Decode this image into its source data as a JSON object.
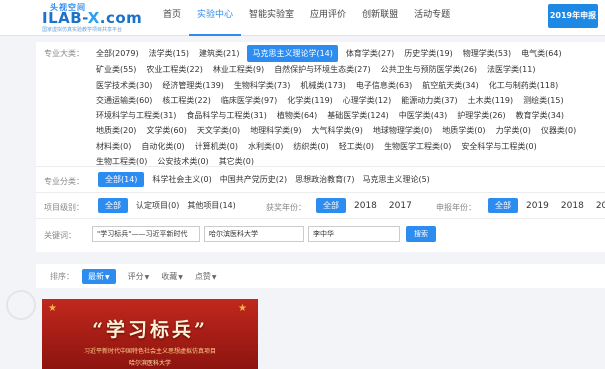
{
  "logo": {
    "top": "头视空间",
    "main": "ILAB-",
    "main_x": "X",
    "main_tail": ".com",
    "sub": "国家虚拟仿真实验教学项目共享平台"
  },
  "nav": [
    "首页",
    "实验中心",
    "智能实验室",
    "应用评价",
    "创新联盟",
    "活动专题"
  ],
  "nav_active": 1,
  "year_badge": "2019年申报",
  "filters": {
    "major_label": "专业大类：",
    "categories": [
      "全部(2079)",
      "法学类(15)",
      "建筑类(21)",
      "马克思主义理论学(14)",
      "体育学类(27)",
      "历史学类(19)",
      "物理学类(53)",
      "电气类(64)",
      "矿业类(55)",
      "农业工程类(22)",
      "林业工程类(9)",
      "自然保护与环境生态类(27)",
      "公共卫生与预防医学类(26)",
      "法医学类(11)",
      "医学技术类(30)",
      "经济管理类(139)",
      "生物科学类(73)",
      "机械类(173)",
      "电子信息类(63)",
      "航空航天类(34)",
      "化工与制药类(118)",
      "交通运输类(60)",
      "核工程类(22)",
      "临床医学类(97)",
      "化学类(119)",
      "心理学类(12)",
      "能源动力类(37)",
      "土木类(119)",
      "测绘类(15)",
      "环境科学与工程类(31)",
      "食品科学与工程类(31)",
      "植物类(64)",
      "基础医学类(124)",
      "中医学类(43)",
      "护理学类(26)",
      "教育学类(34)",
      "地质类(20)",
      "文学类(60)",
      "天文学类(0)",
      "地理科学类(9)",
      "大气科学类(9)",
      "地球物理学类(0)",
      "地质学类(0)",
      "力学类(0)",
      "仪器类(0)",
      "材料类(0)",
      "自动化类(0)",
      "计算机类(0)",
      "水利类(0)",
      "纺织类(0)",
      "轻工类(0)",
      "生物医学工程类(0)",
      "安全科学与工程类(0)",
      "生物工程类(0)",
      "公安技术类(0)",
      "其它类(0)"
    ],
    "selected_category": 3,
    "sub_label": "专业分类：",
    "sub_options": [
      "全部(14)",
      "科学社会主义(0)",
      "中国共产党历史(2)",
      "思想政治教育(7)",
      "马克思主义理论(5)"
    ],
    "level_label": "项目级别：",
    "level_options": [
      "全部",
      "认定项目(0)",
      "其他项目(14)"
    ],
    "award_label": "获奖年份：",
    "award_options": [
      "全部",
      "2018",
      "2017"
    ],
    "apply_label": "申报年份：",
    "apply_options": [
      "全部",
      "2019",
      "2018",
      "20"
    ],
    "keyword_label": "关键词：",
    "keyword_value": "\"学习标兵\"——习近平新时代",
    "school_value": "哈尔滨医科大学",
    "person_value": "李中华",
    "search_label": "搜索"
  },
  "sort": {
    "label": "排序：",
    "items": [
      "最新",
      "评分",
      "收藏",
      "点赞"
    ],
    "selected": 0
  },
  "banner": {
    "title": "“学习标兵”",
    "subtitle": "习近平新时代中国特色社会主义思想虚拟仿真项目",
    "org": "哈尔滨医科大学"
  },
  "colors": {
    "accent": "#2d8cf0",
    "banner": "#c0281d"
  }
}
